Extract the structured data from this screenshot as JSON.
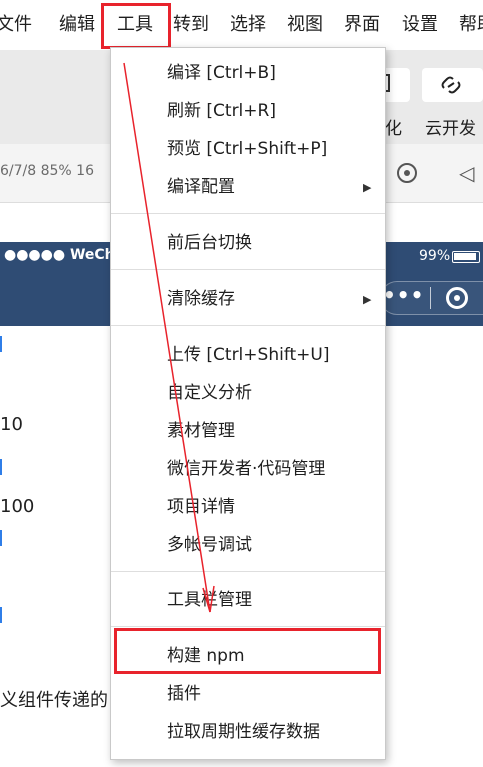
{
  "menubar": {
    "items": [
      "文件",
      "编辑",
      "工具",
      "转到",
      "选择",
      "视图",
      "界面",
      "设置",
      "帮助"
    ]
  },
  "toolbar": {
    "visualize_label": "化",
    "cloud_dev_label": "云开发"
  },
  "simulator": {
    "device_info": "6/7/8 85% 16"
  },
  "phone": {
    "carrier": "●●●●● WeChat",
    "battery_percent": "99%",
    "capsule_dots": "•••",
    "content": {
      "line1": "10",
      "line2": "100",
      "line3": "义组件传递的"
    }
  },
  "dropdown": {
    "groups": [
      [
        {
          "label": "编译  [Ctrl+B]",
          "submenu": false
        },
        {
          "label": "刷新  [Ctrl+R]",
          "submenu": false
        },
        {
          "label": "预览  [Ctrl+Shift+P]",
          "submenu": false
        },
        {
          "label": "编译配置",
          "submenu": true
        }
      ],
      [
        {
          "label": "前后台切换",
          "submenu": false
        }
      ],
      [
        {
          "label": "清除缓存",
          "submenu": true
        }
      ],
      [
        {
          "label": "上传  [Ctrl+Shift+U]",
          "submenu": false
        },
        {
          "label": "自定义分析",
          "submenu": false
        },
        {
          "label": "素材管理",
          "submenu": false
        },
        {
          "label": "微信开发者·代码管理",
          "submenu": false
        },
        {
          "label": "项目详情",
          "submenu": false
        },
        {
          "label": "多帐号调试",
          "submenu": false
        }
      ],
      [
        {
          "label": "工具栏管理",
          "submenu": false
        }
      ],
      [
        {
          "label": "构建 npm",
          "submenu": false
        },
        {
          "label": "插件",
          "submenu": false
        },
        {
          "label": "拉取周期性缓存数据",
          "submenu": false
        }
      ]
    ]
  },
  "colors": {
    "highlight_red": "#e8232c",
    "nav_blue": "#2f4c74",
    "toolbar_gray": "#eaeaea"
  },
  "icons": {
    "submenu_arrow": "triangle-right-icon",
    "toolbar_link": "link-icon",
    "sim_record": "record-icon",
    "sim_speaker": "speaker-icon",
    "capsule_close": "target-icon"
  }
}
